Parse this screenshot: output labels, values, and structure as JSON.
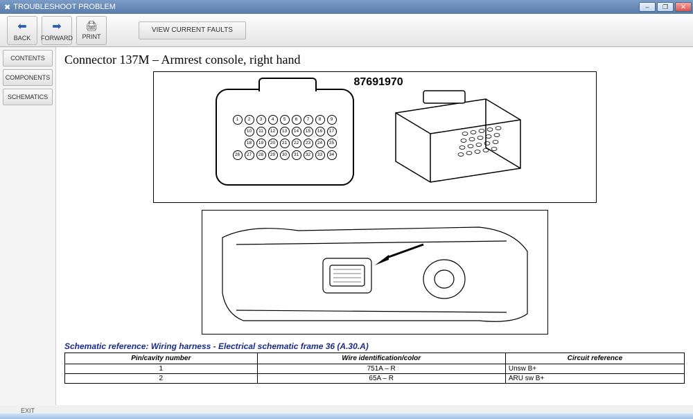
{
  "window": {
    "title": "TROUBLESHOOT PROBLEM",
    "minimize": "–",
    "maximize": "❐",
    "close": "✕"
  },
  "toolbar": {
    "back": "BACK",
    "forward": "FORWARD",
    "print": "PRINT",
    "view_faults": "VIEW CURRENT FAULTS"
  },
  "sidebar": {
    "contents": "CONTENTS",
    "components": "COMPONENTS",
    "schematics": "SCHEMATICS"
  },
  "page": {
    "heading": "Connector 137M – Armrest console, right hand",
    "part_number": "87691970",
    "schematic_reference": "Schematic reference: Wiring harness - Electrical schematic frame 36 (A.30.A)"
  },
  "pin_table": {
    "headers": [
      "Pin/cavity number",
      "Wire identification/color",
      "Circuit reference"
    ],
    "rows": [
      {
        "pin": "1",
        "wire": "751A – R",
        "circuit": "Unsw B+"
      },
      {
        "pin": "2",
        "wire": "65A – R",
        "circuit": "ARU sw B+"
      }
    ]
  },
  "connector_pins": {
    "row1": [
      1,
      2,
      3,
      4,
      5,
      6,
      7,
      8,
      9
    ],
    "row2": [
      10,
      11,
      12,
      13,
      14,
      15,
      16,
      17
    ],
    "row3": [
      18,
      19,
      20,
      21,
      22,
      23,
      24,
      25
    ],
    "row4": [
      26,
      27,
      28,
      29,
      30,
      31,
      32,
      33,
      34
    ]
  },
  "footer": {
    "exit": "EXIT"
  }
}
